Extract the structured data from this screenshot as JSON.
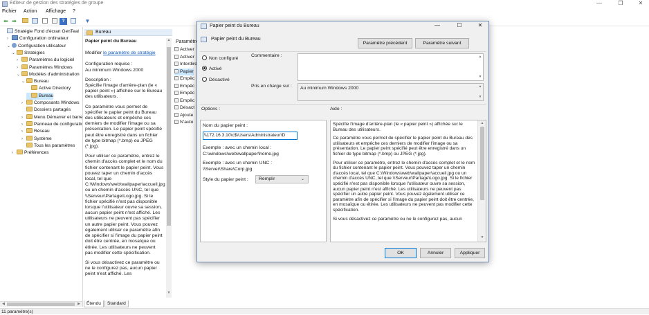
{
  "window": {
    "title": "Éditeur de gestion des stratégies de groupe",
    "minimize": "—",
    "maximize": "❐",
    "close": "✕"
  },
  "menu": [
    "Fichier",
    "Action",
    "Affichage",
    "?"
  ],
  "toolbar": {
    "icons": [
      "back-arrow-icon",
      "forward-arrow-icon",
      "up-folder-icon",
      "show-hide-tree-icon",
      "export-list-icon",
      "help-icon",
      "properties-icon",
      "filter-icon"
    ]
  },
  "tree": {
    "items": [
      {
        "label": "Stratégie Fond d'écran GenTeal",
        "level": 0,
        "expander": "",
        "icon": "policy"
      },
      {
        "label": "Configuration ordinateur",
        "level": 1,
        "expander": ">",
        "icon": "pc"
      },
      {
        "label": "Configuration utilisateur",
        "level": 1,
        "expander": "v",
        "icon": "user"
      },
      {
        "label": "Stratégies",
        "level": 2,
        "expander": "v",
        "icon": "folder"
      },
      {
        "label": "Paramètres du logiciel",
        "level": 3,
        "expander": ">",
        "icon": "folder"
      },
      {
        "label": "Paramètres Windows",
        "level": 3,
        "expander": ">",
        "icon": "folder"
      },
      {
        "label": "Modèles d'administration",
        "level": 3,
        "expander": "v",
        "icon": "folder"
      },
      {
        "label": "Bureau",
        "level": 4,
        "expander": "v",
        "icon": "folder"
      },
      {
        "label": "Active Directory",
        "level": 5,
        "expander": "",
        "icon": "folder"
      },
      {
        "label": "Bureau",
        "level": 5,
        "expander": "",
        "icon": "folder",
        "selected": true
      },
      {
        "label": "Composants Windows",
        "level": 4,
        "expander": ">",
        "icon": "folder"
      },
      {
        "label": "Dossiers partagés",
        "level": 4,
        "expander": "",
        "icon": "folder"
      },
      {
        "label": "Menu Démarrer et barre des tâches",
        "level": 4,
        "expander": ">",
        "icon": "folder"
      },
      {
        "label": "Panneau de configuration",
        "level": 4,
        "expander": ">",
        "icon": "folder"
      },
      {
        "label": "Réseau",
        "level": 4,
        "expander": ">",
        "icon": "folder"
      },
      {
        "label": "Système",
        "level": 4,
        "expander": ">",
        "icon": "folder"
      },
      {
        "label": "Tous les paramètres",
        "level": 4,
        "expander": "",
        "icon": "folder"
      },
      {
        "label": "Préférences",
        "level": 2,
        "expander": ">",
        "icon": "folder"
      }
    ]
  },
  "extended": {
    "header": "Bureau",
    "setting_title": "Papier peint du Bureau",
    "modify_prefix": "Modifier ",
    "modify_link": "le paramètre de stratégie",
    "requirement_label": "Configuration requise :",
    "requirement_value": "Au minimum Windows 2000",
    "description_label": "Description :",
    "paragraphs": [
      "Spécifie l'image d'arrière-plan (le « papier peint ») affichée sur le Bureau des utilisateurs.",
      "Ce paramètre vous permet de spécifier le papier peint du Bureau des utilisateurs et empêche ces derniers de modifier l'image ou sa présentation. Le papier peint spécifié peut être enregistré dans un fichier de type bitmap (*.bmp) ou JPEG (*.jpg).",
      "Pour utiliser ce paramètre, entrez le chemin d'accès complet et le nom du fichier contenant le papier peint. Vous pouvez taper un chemin d'accès local, tel que C:\\Windows\\web\\wallpaper\\accueil.jpg ou un chemin d'accès UNC, tel que \\\\Serveur\\Partage\\Logo.jpg. Si le fichier spécifié n'est pas disponible lorsque l'utilisateur ouvre sa session, aucun papier peint n'est affiché. Les utilisateurs ne peuvent pas spécifier un autre papier peint. Vous pouvez également utiliser ce paramètre afin de spécifier si l'image du papier peint doit être centrée, en mosaïque ou étirée. Les utilisateurs ne peuvent pas modifier cette spécification.",
      "Si vous désactivez ce paramètre ou ne le configurez pas, aucun papier peint n'est affiché. Les"
    ]
  },
  "settings": {
    "column_header": "Paramètre",
    "rows": [
      "Activer",
      "Activer",
      "Interdire",
      "Papier",
      "Empêc",
      "Empêc",
      "Empêc",
      "Empêc",
      "Désact",
      "Ajoute",
      "N'auto"
    ]
  },
  "tabs": {
    "extended": "Étendu",
    "standard": "Standard"
  },
  "status": "11 paramètre(s)",
  "dialog": {
    "title": "Papier peint du Bureau",
    "setting_name": "Papier peint du Bureau",
    "prev_button": "Paramètre précédent",
    "next_button": "Paramètre suivant",
    "radio_not_configured": "Non configuré",
    "radio_enabled": "Activé",
    "radio_disabled": "Désactivé",
    "selected_state": "Activé",
    "comment_label": "Commentaire :",
    "comment_value": "",
    "supported_label": "Pris en charge sur :",
    "supported_value": "Au minimum Windows 2000",
    "options_label": "Options :",
    "help_label": "Aide :",
    "wallpaper_name_label": "Nom du papier peint :",
    "wallpaper_name_value": "\\\\172.16.3.10\\c$\\Users\\Administrateur\\D",
    "example_local": "Exemple : avec un chemin local :",
    "example_local_path": "C:\\windows\\web\\wallpaper\\home.jpg",
    "example_unc": "Exemple : avec un chemin UNC :",
    "example_unc_path": "\\\\Server\\Share\\Corp.jpg",
    "style_label": "Style du papier peint :",
    "style_value": "Remplir",
    "help_paragraphs": [
      "Spécifie l'image d'arrière-plan (le « papier peint ») affichée sur le Bureau des utilisateurs.",
      "Ce paramètre vous permet de spécifier le papier peint du Bureau des utilisateurs et empêche ces derniers de modifier l'image ou sa présentation. Le papier peint spécifié peut être enregistré dans un fichier de type bitmap (*.bmp) ou JPEG (*.jpg).",
      "Pour utiliser ce paramètre, entrez le chemin d'accès complet et le nom du fichier contenant le papier peint. Vous pouvez taper un chemin d'accès local, tel que C:\\Windows\\web\\wallpaper\\accueil.jpg ou un chemin d'accès UNC, tel que \\\\Serveur\\Partage\\Logo.jpg. Si le fichier spécifié n'est pas disponible lorsque l'utilisateur ouvre sa session, aucun papier peint n'est affiché. Les utilisateurs ne peuvent pas spécifier un autre papier peint. Vous pouvez également utiliser ce paramètre afin de spécifier si l'image du papier peint doit être centrée, en mosaïque ou étirée. Les utilisateurs ne peuvent pas modifier cette spécification.",
      "Si vous désactivez ce paramètre ou ne le configurez pas, aucun"
    ],
    "ok_button": "OK",
    "cancel_button": "Annuler",
    "apply_button": "Appliquer",
    "minimize": "—",
    "maximize": "☐",
    "close": "✕"
  },
  "colors": {
    "selection": "#cce8ff",
    "link": "#0b57b8",
    "dialog_bg": "#f0f0f0",
    "accent_border": "#0078d7"
  }
}
